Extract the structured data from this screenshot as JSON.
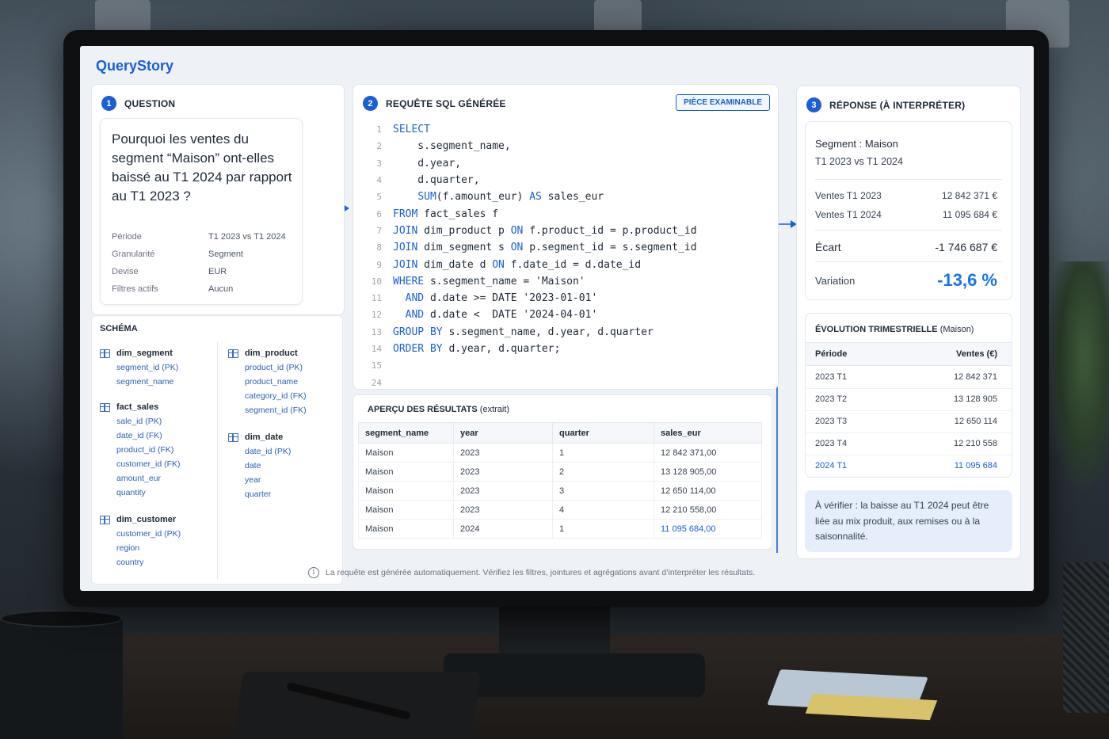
{
  "app": {
    "title": "QueryStory"
  },
  "question": {
    "step": "1",
    "heading": "QUESTION",
    "text": "Pourquoi les ventes du segment “Maison” ont-elles baissé au T1 2024 par rapport au T1 2023 ?",
    "meta": [
      {
        "key": "Période",
        "value": "T1 2023 vs T1 2024"
      },
      {
        "key": "Granularité",
        "value": "Segment"
      },
      {
        "key": "Devise",
        "value": "EUR"
      },
      {
        "key": "Filtres actifs",
        "value": "Aucun"
      }
    ]
  },
  "schema": {
    "title": "SCHÉMA",
    "tables": [
      {
        "name": "dim_segment",
        "columns": [
          "segment_id (PK)",
          "segment_name"
        ]
      },
      {
        "name": "fact_sales",
        "columns": [
          "sale_id (PK)",
          "date_id (FK)",
          "product_id (FK)",
          "customer_id (FK)",
          "amount_eur",
          "quantity"
        ]
      },
      {
        "name": "dim_customer",
        "columns": [
          "customer_id (PK)",
          "region",
          "country"
        ]
      },
      {
        "name": "dim_product",
        "columns": [
          "product_id (PK)",
          "product_name",
          "category_id (FK)",
          "segment_id (FK)"
        ]
      },
      {
        "name": "dim_date",
        "columns": [
          "date_id (PK)",
          "date",
          "year",
          "quarter"
        ]
      }
    ]
  },
  "sql": {
    "step": "2",
    "heading": "REQUÊTE SQL GÉNÉRÉE",
    "badge": "PIÈCE EXAMINABLE",
    "lines": [
      {
        "n": "1",
        "parts": [
          [
            "kw",
            "SELECT"
          ]
        ]
      },
      {
        "n": "2",
        "parts": [
          [
            "t",
            "    s.segment_name,"
          ]
        ]
      },
      {
        "n": "3",
        "parts": [
          [
            "t",
            "    d.year,"
          ]
        ]
      },
      {
        "n": "4",
        "parts": [
          [
            "t",
            "    d.quarter,"
          ]
        ]
      },
      {
        "n": "5",
        "parts": [
          [
            "t",
            "    "
          ],
          [
            "kw",
            "SUM"
          ],
          [
            "t",
            "(f.amount_eur) "
          ],
          [
            "kw",
            "AS"
          ],
          [
            "t",
            " sales_eur"
          ]
        ]
      },
      {
        "n": "6",
        "parts": [
          [
            "kw",
            "FROM"
          ],
          [
            "t",
            " fact_sales f"
          ]
        ]
      },
      {
        "n": "7",
        "parts": [
          [
            "kw",
            "JOIN"
          ],
          [
            "t",
            " dim_product p "
          ],
          [
            "kw",
            "ON"
          ],
          [
            "t",
            " f.product_id = p.product_id"
          ]
        ]
      },
      {
        "n": "8",
        "parts": [
          [
            "kw",
            "JOIN"
          ],
          [
            "t",
            " dim_segment s "
          ],
          [
            "kw",
            "ON"
          ],
          [
            "t",
            " p.segment_id = s.segment_id"
          ]
        ]
      },
      {
        "n": "9",
        "parts": [
          [
            "kw",
            "JOIN"
          ],
          [
            "t",
            " dim_date d "
          ],
          [
            "kw",
            "ON"
          ],
          [
            "t",
            " f.date_id = d.date_id"
          ]
        ]
      },
      {
        "n": "10",
        "parts": [
          [
            "kw",
            "WHERE"
          ],
          [
            "t",
            " s.segment_name = 'Maison'"
          ]
        ]
      },
      {
        "n": "11",
        "parts": [
          [
            "t",
            "  "
          ],
          [
            "kw",
            "AND"
          ],
          [
            "t",
            " d.date >= DATE '2023-01-01'"
          ]
        ]
      },
      {
        "n": "12",
        "parts": [
          [
            "t",
            "  "
          ],
          [
            "kw",
            "AND"
          ],
          [
            "t",
            " d.date <  DATE '2024-04-01'"
          ]
        ]
      },
      {
        "n": "13",
        "parts": [
          [
            "kw",
            "GROUP BY"
          ],
          [
            "t",
            " s.segment_name, d.year, d.quarter"
          ]
        ]
      },
      {
        "n": "14",
        "parts": [
          [
            "kw",
            "ORDER BY"
          ],
          [
            "t",
            " d.year, d.quarter;"
          ]
        ]
      },
      {
        "n": "15",
        "parts": []
      },
      {
        "n": "24",
        "parts": []
      }
    ]
  },
  "results": {
    "title": "APERÇU DES RÉSULTATS",
    "subtitle": "(extrait)",
    "headers": [
      "segment_name",
      "year",
      "quarter",
      "sales_eur"
    ],
    "rows": [
      [
        "Maison",
        "2023",
        "1",
        "12 842 371,00"
      ],
      [
        "Maison",
        "2023",
        "2",
        "13 128 905,00"
      ],
      [
        "Maison",
        "2023",
        "3",
        "12 650 114,00"
      ],
      [
        "Maison",
        "2023",
        "4",
        "12 210 558,00"
      ],
      [
        "Maison",
        "2024",
        "1",
        "11 095 684,00"
      ]
    ]
  },
  "answer": {
    "step": "3",
    "heading": "RÉPONSE (À INTERPRÉTER)",
    "segment_label": "Segment :",
    "segment_value": "Maison",
    "comparison": "T1 2023 vs T1 2024",
    "sales_2023_label": "Ventes T1 2023",
    "sales_2023_value": "12 842 371 €",
    "sales_2024_label": "Ventes T1 2024",
    "sales_2024_value": "11 095 684 €",
    "gap_label": "Écart",
    "gap_value": "-1 746 687 €",
    "variation_label": "Variation",
    "variation_value": "-13,6 %"
  },
  "evolution": {
    "title": "ÉVOLUTION TRIMESTRIELLE",
    "title_suffix": "(Maison)",
    "col_period": "Période",
    "col_sales": "Ventes (€)",
    "rows": [
      {
        "period": "2023 T1",
        "sales": "12 842 371"
      },
      {
        "period": "2023 T2",
        "sales": "13 128 905"
      },
      {
        "period": "2023 T3",
        "sales": "12 650 114"
      },
      {
        "period": "2023 T4",
        "sales": "12 210 558"
      },
      {
        "period": "2024 T1",
        "sales": "11 095 684"
      }
    ]
  },
  "note": "À vérifier : la baisse au T1 2024 peut être liée au mix produit, aux remises ou à la saisonnalité.",
  "footer": "La requête est générée automatiquement. Vérifiez les filtres, jointures et agrégations avant d’interpréter les résultats.",
  "colors": {
    "accent": "#1a5fd6",
    "variation": "#1a73e8"
  }
}
